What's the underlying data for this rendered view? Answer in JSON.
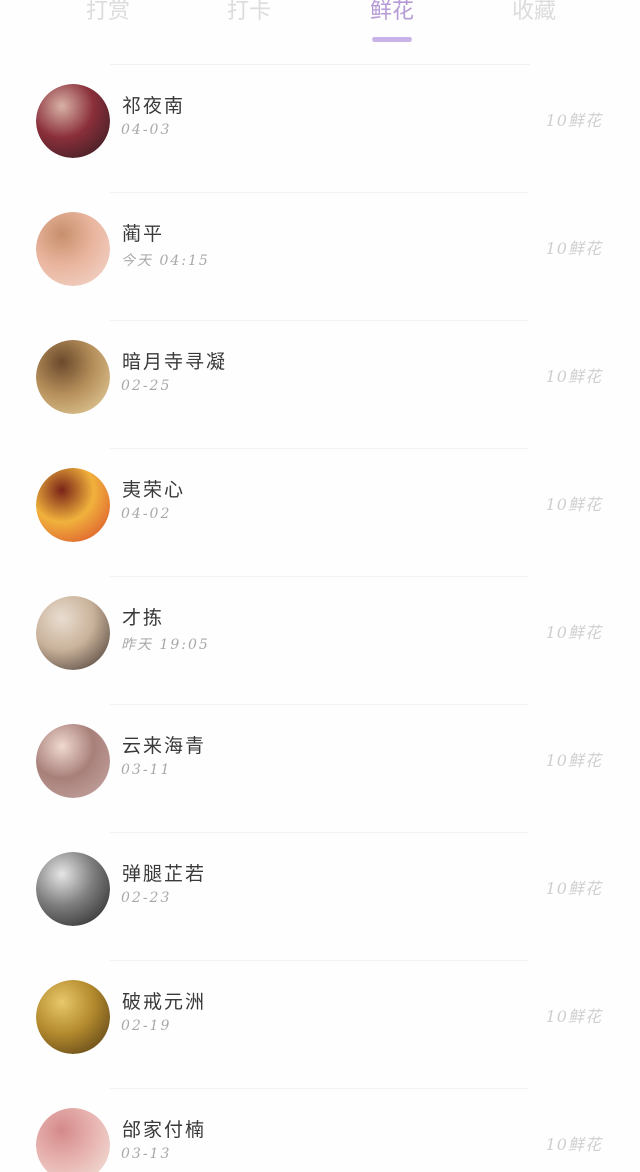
{
  "tabs": [
    {
      "label": "打赏",
      "active": false
    },
    {
      "label": "打卡",
      "active": false
    },
    {
      "label": "鲜花",
      "active": true
    },
    {
      "label": "收藏",
      "active": false
    }
  ],
  "colors": {
    "accent": "#b59ad6",
    "indicator": "#c7b3e8",
    "inactive_tab": "#dcdcdc",
    "name_text": "#3a3a3a",
    "time_text": "#a8a8a8",
    "amount_text": "#cfcfcf"
  },
  "records": [
    {
      "name": "祁夜南",
      "time": "04-03",
      "amount": "10鲜花",
      "avatar_icon": "avatar-photo-icon",
      "avatar_colors": [
        "#2b1a1f",
        "#8a2f3a",
        "#d9b2a6"
      ]
    },
    {
      "name": "蔺平",
      "time": "今天 04:15",
      "amount": "10鲜花",
      "avatar_icon": "avatar-photo-icon",
      "avatar_colors": [
        "#f3d9cf",
        "#e9b59e",
        "#c78f6c"
      ]
    },
    {
      "name": "暗月寺寻凝",
      "time": "02-25",
      "amount": "10鲜花",
      "avatar_icon": "avatar-photo-icon",
      "avatar_colors": [
        "#e9d6a2",
        "#b58e5a",
        "#6b4a2c"
      ]
    },
    {
      "name": "夷荣心",
      "time": "04-02",
      "amount": "10鲜花",
      "avatar_icon": "avatar-photo-icon",
      "avatar_colors": [
        "#d8432b",
        "#f1b23c",
        "#7a2418"
      ]
    },
    {
      "name": "才拣",
      "time": "昨天 19:05",
      "amount": "10鲜花",
      "avatar_icon": "avatar-photo-icon",
      "avatar_colors": [
        "#3b2f2a",
        "#c9b29a",
        "#e9ddd0"
      ]
    },
    {
      "name": "云来海青",
      "time": "03-11",
      "amount": "10鲜花",
      "avatar_icon": "avatar-photo-icon",
      "avatar_colors": [
        "#c9a9a6",
        "#a8807a",
        "#f0d9d0"
      ]
    },
    {
      "name": "弹腿芷若",
      "time": "02-23",
      "amount": "10鲜花",
      "avatar_icon": "avatar-photo-icon",
      "avatar_colors": [
        "#1e1e1e",
        "#7d7d7d",
        "#e6e6e6"
      ]
    },
    {
      "name": "破戒元洲",
      "time": "02-19",
      "amount": "10鲜花",
      "avatar_icon": "avatar-photo-icon",
      "avatar_colors": [
        "#4a3512",
        "#b48a2e",
        "#e7c86a"
      ]
    },
    {
      "name": "邰家付楠",
      "time": "03-13",
      "amount": "10鲜花",
      "avatar_icon": "avatar-photo-icon",
      "avatar_colors": [
        "#f4e6dc",
        "#e7b3b0",
        "#d48a8a"
      ]
    }
  ]
}
